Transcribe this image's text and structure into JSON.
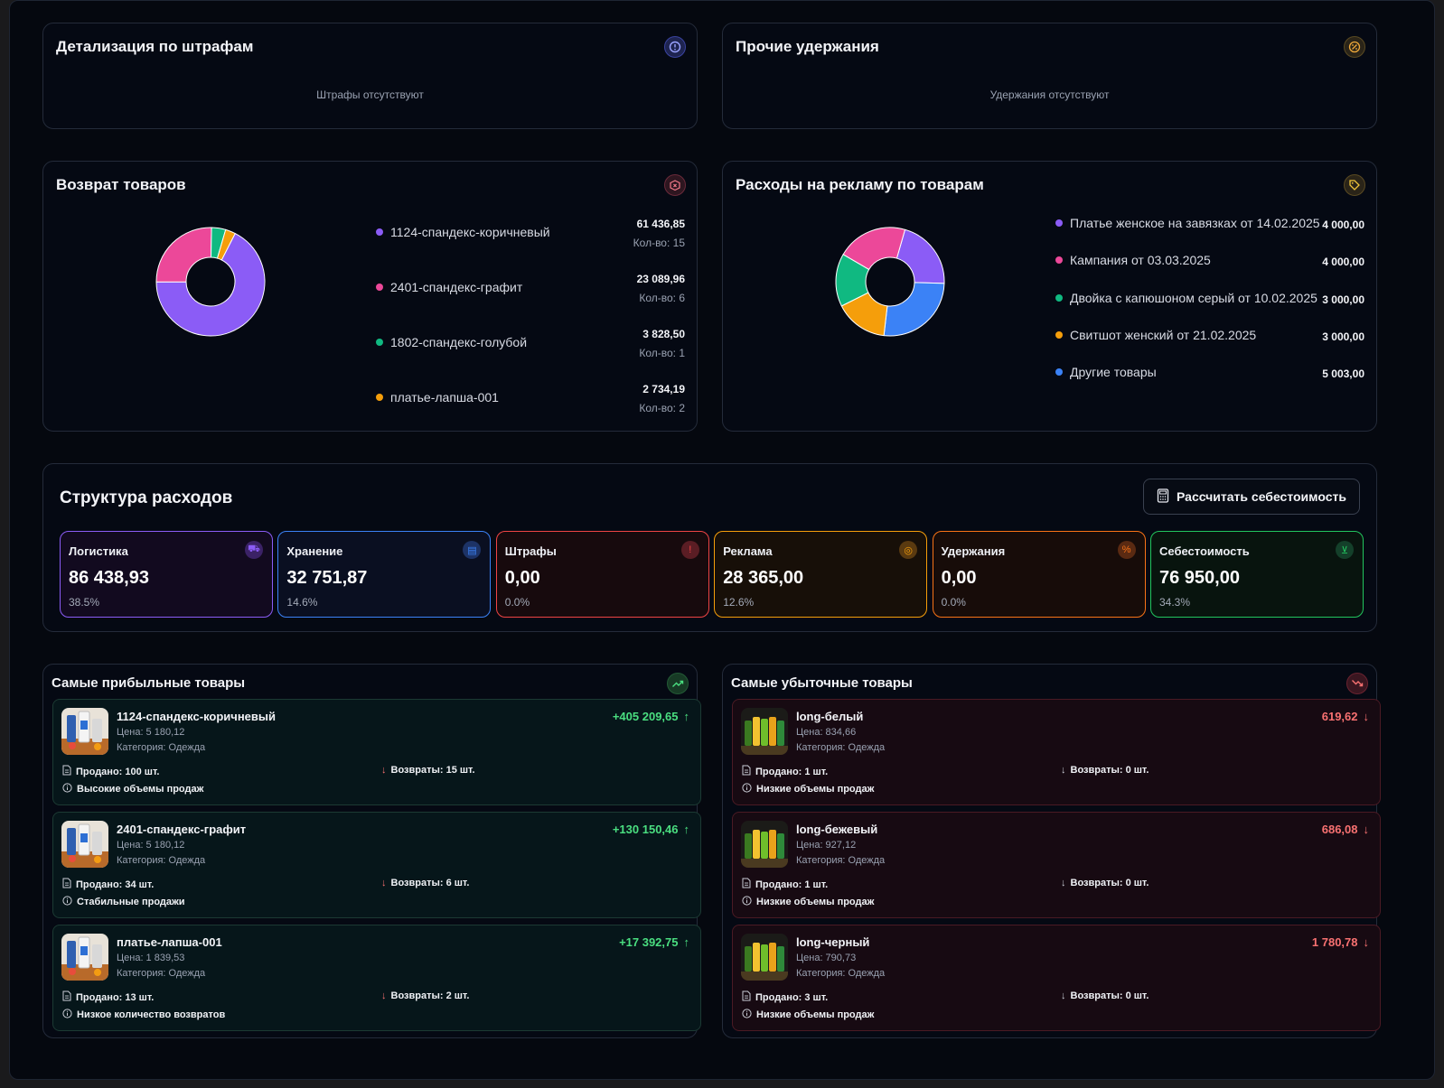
{
  "penalties": {
    "title": "Детализация по штрафам",
    "empty": "Штрафы отсутствуют",
    "icon": "alert-circle-icon"
  },
  "deductions": {
    "title": "Прочие удержания",
    "empty": "Удержания отсутствуют",
    "icon": "percent-icon"
  },
  "returns": {
    "title": "Возврат товаров",
    "icon": "package-x-icon",
    "items": [
      {
        "label": "1124-спандекс-коричневый",
        "value": "61 436,85",
        "count": "Кол-во: 15",
        "color": "#8b5cf6"
      },
      {
        "label": "2401-спандекс-графит",
        "value": "23 089,96",
        "count": "Кол-во: 6",
        "color": "#ec4899"
      },
      {
        "label": "1802-спандекс-голубой",
        "value": "3 828,50",
        "count": "Кол-во: 1",
        "color": "#10b981"
      },
      {
        "label": "платье-лапша-001",
        "value": "2 734,19",
        "count": "Кол-во: 2",
        "color": "#f59e0b"
      }
    ]
  },
  "ads": {
    "title": "Расходы на рекламу по товарам",
    "icon": "tag-icon",
    "items": [
      {
        "label": "Платье женское на завязках от 14.02.2025",
        "value": "4 000,00",
        "color": "#8b5cf6"
      },
      {
        "label": "Кампания от 03.03.2025",
        "value": "4 000,00",
        "color": "#ec4899"
      },
      {
        "label": "Двойка с капюшоном серый от 10.02.2025",
        "value": "3 000,00",
        "color": "#10b981"
      },
      {
        "label": "Свитшот женский от 21.02.2025",
        "value": "3 000,00",
        "color": "#f59e0b"
      },
      {
        "label": "Другие товары",
        "value": "5 003,00",
        "color": "#3b82f6"
      }
    ]
  },
  "chart_data": [
    {
      "type": "pie",
      "categories": [
        "1124-спандекс-коричневый",
        "2401-спандекс-графит",
        "1802-спандекс-голубой",
        "платье-лапша-001"
      ],
      "values": [
        61436.85,
        23089.96,
        3828.5,
        2734.19
      ],
      "colors": [
        "#8b5cf6",
        "#ec4899",
        "#10b981",
        "#f59e0b"
      ]
    },
    {
      "type": "pie",
      "categories": [
        "Платье женское на завязках от 14.02.2025",
        "Другие товары",
        "Свитшот женский от 21.02.2025",
        "Двойка с капюшоном серый от 10.02.2025",
        "Кампания от 03.03.2025"
      ],
      "values": [
        4000,
        5003,
        3000,
        3000,
        4000
      ],
      "colors": [
        "#8b5cf6",
        "#3b82f6",
        "#f59e0b",
        "#10b981",
        "#ec4899"
      ]
    }
  ],
  "structure": {
    "title": "Структура расходов",
    "calc_button": "Рассчитать себестоимость",
    "metrics": [
      {
        "label": "Логистика",
        "value": "86 438,93",
        "pct": "38.5%",
        "color": "#8b5cf6",
        "icon": "truck-icon",
        "glyph": "⛟"
      },
      {
        "label": "Хранение",
        "value": "32 751,87",
        "pct": "14.6%",
        "color": "#3b82f6",
        "icon": "warehouse-icon",
        "glyph": "▤"
      },
      {
        "label": "Штрафы",
        "value": "0,00",
        "pct": "0.0%",
        "color": "#ef4444",
        "icon": "alert-circle-icon",
        "glyph": "!"
      },
      {
        "label": "Реклама",
        "value": "28 365,00",
        "pct": "12.6%",
        "color": "#f59e0b",
        "icon": "target-icon",
        "glyph": "◎"
      },
      {
        "label": "Удержания",
        "value": "0,00",
        "pct": "0.0%",
        "color": "#f97316",
        "icon": "coins-icon",
        "glyph": "%"
      },
      {
        "label": "Себестоимость",
        "value": "76 950,00",
        "pct": "34.3%",
        "color": "#22c55e",
        "icon": "cart-icon",
        "glyph": "⊻"
      }
    ]
  },
  "profitable": {
    "title": "Самые прибыльные товары",
    "icon": "trending-up-icon",
    "items": [
      {
        "name": "1124-спандекс-коричневый",
        "price": "Цена: 5 180,12",
        "category": "Категория: Одежда",
        "amount": "+405 209,65",
        "sold": "Продано: 100 шт.",
        "returns": "Возвраты: 15 шт.",
        "note": "Высокие объемы продаж"
      },
      {
        "name": "2401-спандекс-графит",
        "price": "Цена: 5 180,12",
        "category": "Категория: Одежда",
        "amount": "+130 150,46",
        "sold": "Продано: 34 шт.",
        "returns": "Возвраты: 6 шт.",
        "note": "Стабильные продажи"
      },
      {
        "name": "платье-лапша-001",
        "price": "Цена: 1 839,53",
        "category": "Категория: Одежда",
        "amount": "+17 392,75",
        "sold": "Продано: 13 шт.",
        "returns": "Возвраты: 2 шт.",
        "note": "Низкое количество возвратов"
      }
    ]
  },
  "unprofitable": {
    "title": "Самые убыточные товары",
    "icon": "trending-down-icon",
    "items": [
      {
        "name": "long-белый",
        "price": "Цена: 834,66",
        "category": "Категория: Одежда",
        "amount": "619,62",
        "sold": "Продано: 1 шт.",
        "returns": "Возвраты: 0 шт.",
        "note": "Низкие объемы продаж"
      },
      {
        "name": "long-бежевый",
        "price": "Цена: 927,12",
        "category": "Категория: Одежда",
        "amount": "686,08",
        "sold": "Продано: 1 шт.",
        "returns": "Возвраты: 0 шт.",
        "note": "Низкие объемы продаж"
      },
      {
        "name": "long-черный",
        "price": "Цена: 790,73",
        "category": "Категория: Одежда",
        "amount": "1 780,78",
        "sold": "Продано: 3 шт.",
        "returns": "Возвраты: 0 шт.",
        "note": "Низкие объемы продаж"
      }
    ]
  }
}
